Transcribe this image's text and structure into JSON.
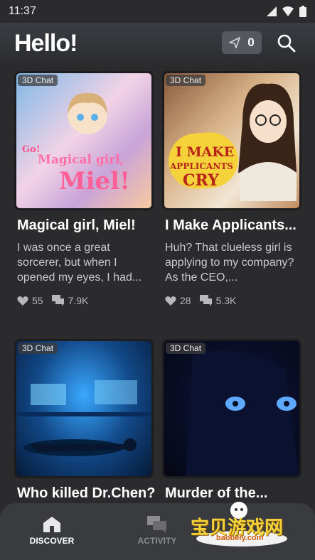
{
  "status": {
    "time": "11:37"
  },
  "header": {
    "title": "Hello!",
    "notification_count": "0"
  },
  "cards": [
    {
      "chip": "3D Chat",
      "title": "Magical girl, Miel!",
      "description": "I was once a great sorcerer, but when I opened my eyes, I had...",
      "likes": "55",
      "chats": "7.9K",
      "art_lines": [
        "Go!",
        "Magical girl,",
        "Miel!"
      ]
    },
    {
      "chip": "3D Chat",
      "title": "I Make Applicants...",
      "description": "Huh? That clueless girl is applying to my company? As the CEO,...",
      "likes": "28",
      "chats": "5.3K",
      "art_lines": [
        "I MAKE",
        "APPLICANTS",
        "CRY"
      ]
    },
    {
      "chip": "3D Chat",
      "title": "Who killed Dr.Chen?"
    },
    {
      "chip": "3D Chat",
      "title": "Murder of the..."
    }
  ],
  "nav": {
    "discover": "DISCOVER",
    "activity": "ACTIVITY"
  },
  "watermark": {
    "text": "宝贝游戏网",
    "url": "baobeiy.com"
  },
  "colors": {
    "background": "#2b2b2d",
    "accent_yellow": "#f5d23a",
    "nav_bg": "#3a3b3f"
  }
}
